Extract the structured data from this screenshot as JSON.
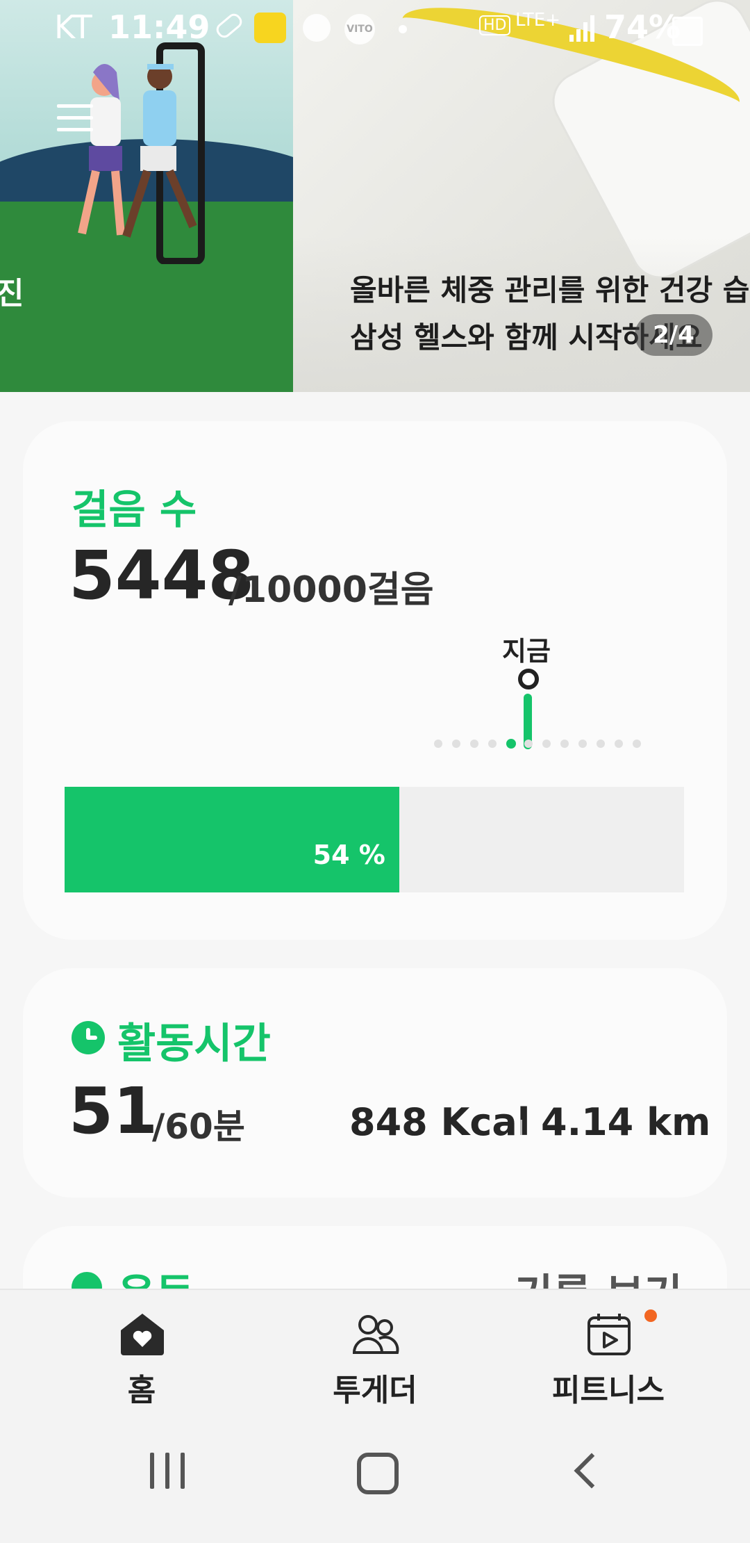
{
  "status_bar": {
    "carrier": "KT",
    "time": "11:49",
    "icons": [
      "pill-icon",
      "kakao-notification-icon",
      "app-icon",
      "vito-icon",
      "dot-icon",
      "hd-icon",
      "lte-icon",
      "signal-icon",
      "battery-icon"
    ],
    "vito_label": "VITO",
    "hd_label": "HD",
    "network": "LTE+",
    "battery": "74%"
  },
  "banner": {
    "slide1_title": "진",
    "slide2_caption_line1": "올바른 체중 관리를 위한 건강 습",
    "slide2_caption_line2": "삼성 헬스와 함께 시작하세요",
    "pager": "2/4"
  },
  "steps_card": {
    "title": "걸음 수",
    "count": "5448",
    "goal": "/10000걸음",
    "now_label": "지금",
    "timeline_dots": 12,
    "active_dot_index": 4,
    "progress_fraction": 0.54,
    "progress_label": "54 %"
  },
  "active_card": {
    "title": "활동시간",
    "minutes": "51",
    "goal": "/60분",
    "kcal": "848 Kcal",
    "distance": "4.14 km"
  },
  "third_card": {
    "title": "운동",
    "right": "기록 보기"
  },
  "bottom_nav": {
    "home": "홈",
    "together": "투게더",
    "fitness": "피트니스"
  },
  "colors": {
    "accent": "#15c46a",
    "badge": "#f26622",
    "card": "#fbfbfb",
    "background": "#f6f6f6"
  }
}
